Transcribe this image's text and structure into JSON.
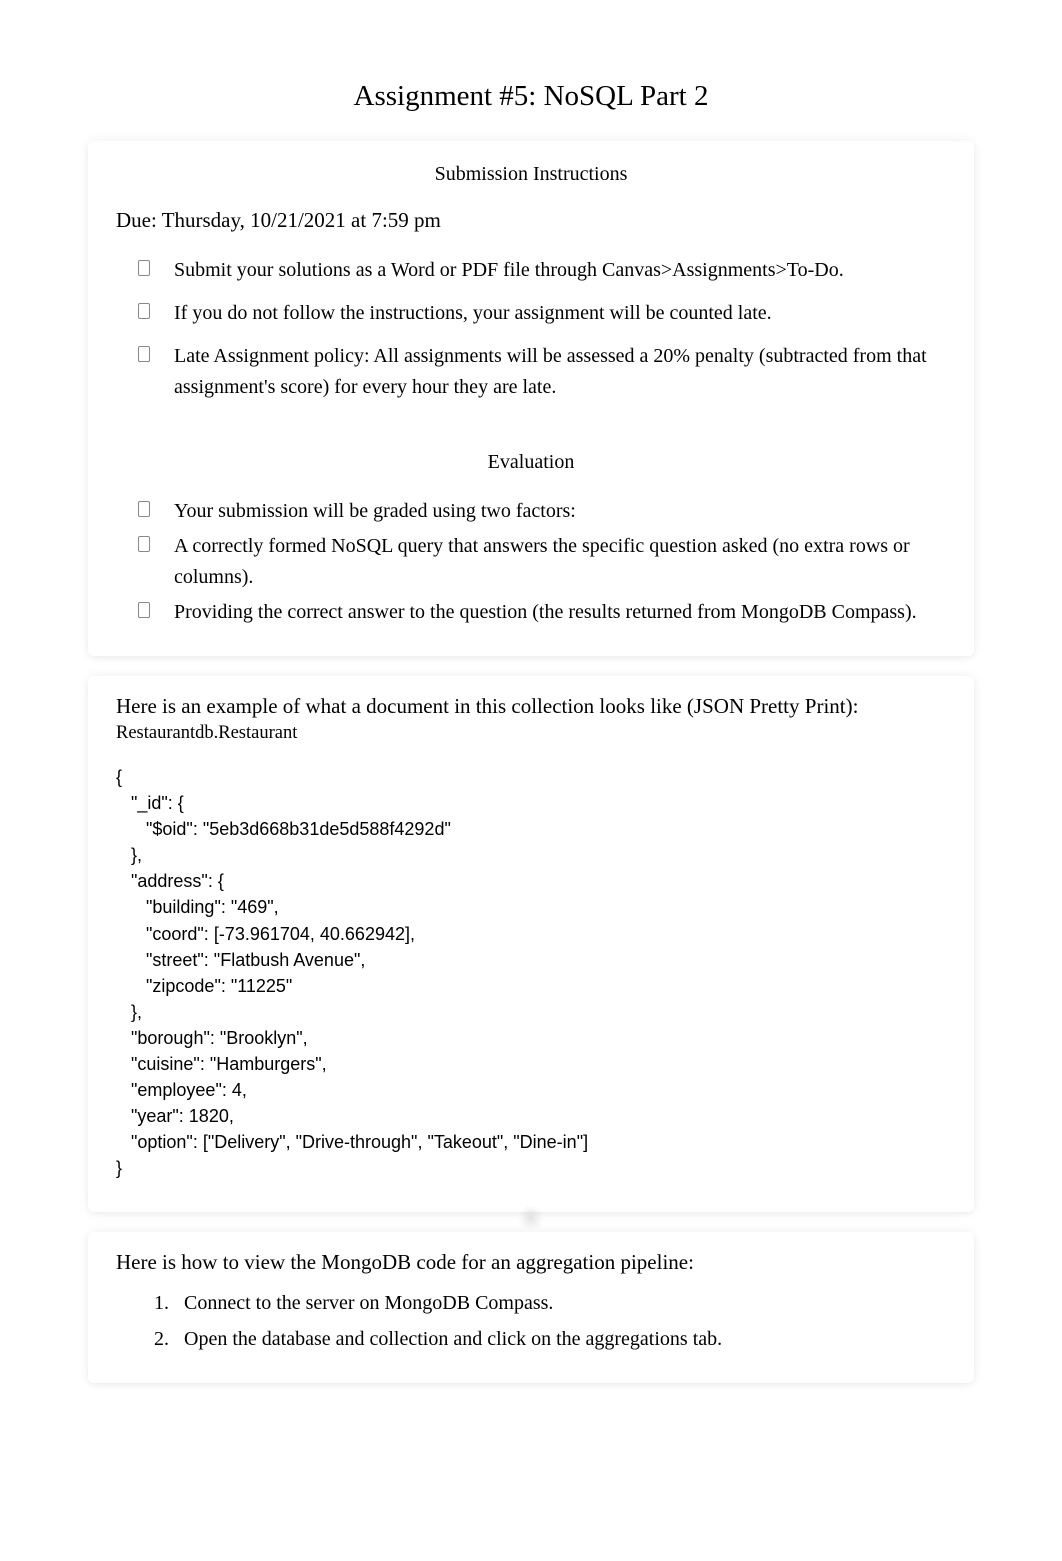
{
  "title": "Assignment #5: NoSQL Part 2",
  "section1": {
    "heading": "Submission Instructions",
    "due": "Due: Thursday, 10/21/2021 at 7:59 pm",
    "bullets": [
      "Submit your solutions as a Word or PDF file through Canvas>Assignments>To-Do.",
      "If you do not follow the instructions, your assignment will be counted late.",
      "Late Assignment policy: All assignments will be assessed a 20% penalty (subtracted from that assignment's score) for every hour they are late."
    ]
  },
  "section2": {
    "heading": "Evaluation",
    "bullets": [
      "Your submission will be graded using two factors:",
      "A correctly formed NoSQL query that answers the specific question asked (no extra rows or columns).",
      "Providing the correct answer   to the question (the results returned from MongoDB Compass)."
    ]
  },
  "example": {
    "intro": "Here is an example of what a document in this collection looks like (JSON Pretty Print):",
    "collection": "Restaurantdb.Restaurant",
    "json": "{\n   \"_id\": {\n      \"$oid\": \"5eb3d668b31de5d588f4292d\"\n   },\n   \"address\": {\n      \"building\": \"469\",\n      \"coord\": [-73.961704, 40.662942],\n      \"street\": \"Flatbush Avenue\",\n      \"zipcode\": \"11225\"\n   },\n   \"borough\": \"Brooklyn\",\n   \"cuisine\": \"Hamburgers\",\n   \"employee\": 4,\n   \"year\": 1820,\n   \"option\": [\"Delivery\", \"Drive-through\", \"Takeout\", \"Dine-in\"]\n}"
  },
  "pipeline": {
    "intro": "Here is how to view the MongoDB code for an aggregation pipeline:",
    "steps": [
      "Connect to the server on MongoDB Compass.",
      "Open the database and collection and click on the aggregations tab."
    ]
  }
}
